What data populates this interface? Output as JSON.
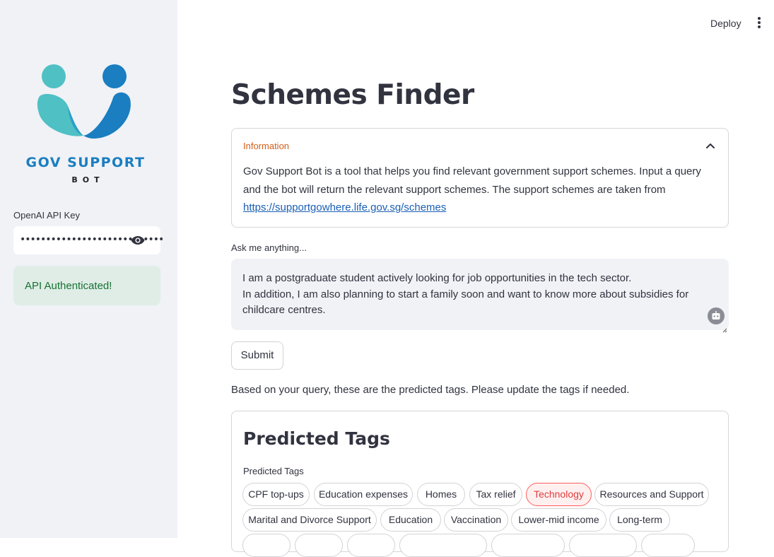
{
  "sidebar": {
    "logo_title": "GOV SUPPORT",
    "logo_sub": "BOT",
    "api_key_label": "OpenAI API Key",
    "api_key_value": "••••••••••••••••••••••••••••",
    "api_status": "API Authenticated!"
  },
  "header": {
    "deploy_label": "Deploy"
  },
  "main": {
    "title": "Schemes Finder",
    "info": {
      "heading": "Information",
      "text": "Gov Support Bot is a tool that helps you find relevant government support schemes. Input a query and the bot will return the relevant support schemes. The support schemes are taken from ",
      "link": "https://supportgowhere.life.gov.sg/schemes"
    },
    "ask_label": "Ask me anything...",
    "query_value": "I am a postgraduate student actively looking for job opportunities in the tech sector.\nIn addition, I am also planning to start a family soon and want to know more about subsidies for childcare centres.",
    "submit_label": "Submit",
    "predicted_note": "Based on your query, these are the predicted tags. Please update the tags if needed.",
    "tags_section": {
      "title": "Predicted Tags",
      "label": "Predicted Tags",
      "tags": [
        {
          "label": "CPF top-ups",
          "selected": false
        },
        {
          "label": "Education expenses",
          "selected": false
        },
        {
          "label": "Homes",
          "selected": false
        },
        {
          "label": "Tax relief",
          "selected": false
        },
        {
          "label": "Technology",
          "selected": true
        },
        {
          "label": "Resources and Support",
          "selected": false
        },
        {
          "label": "Marital and Divorce Support",
          "selected": false
        },
        {
          "label": "Education",
          "selected": false
        },
        {
          "label": "Vaccination",
          "selected": false
        },
        {
          "label": "Lower-mid income",
          "selected": false
        },
        {
          "label": "Long-term",
          "selected": false
        }
      ]
    }
  },
  "colors": {
    "accent": "#ff4b4b",
    "info_heading": "#d2601a",
    "success_bg": "#dfede6",
    "success_text": "#177233",
    "logo_blue": "#1a7ec0",
    "logo_teal": "#4fc0c4"
  }
}
